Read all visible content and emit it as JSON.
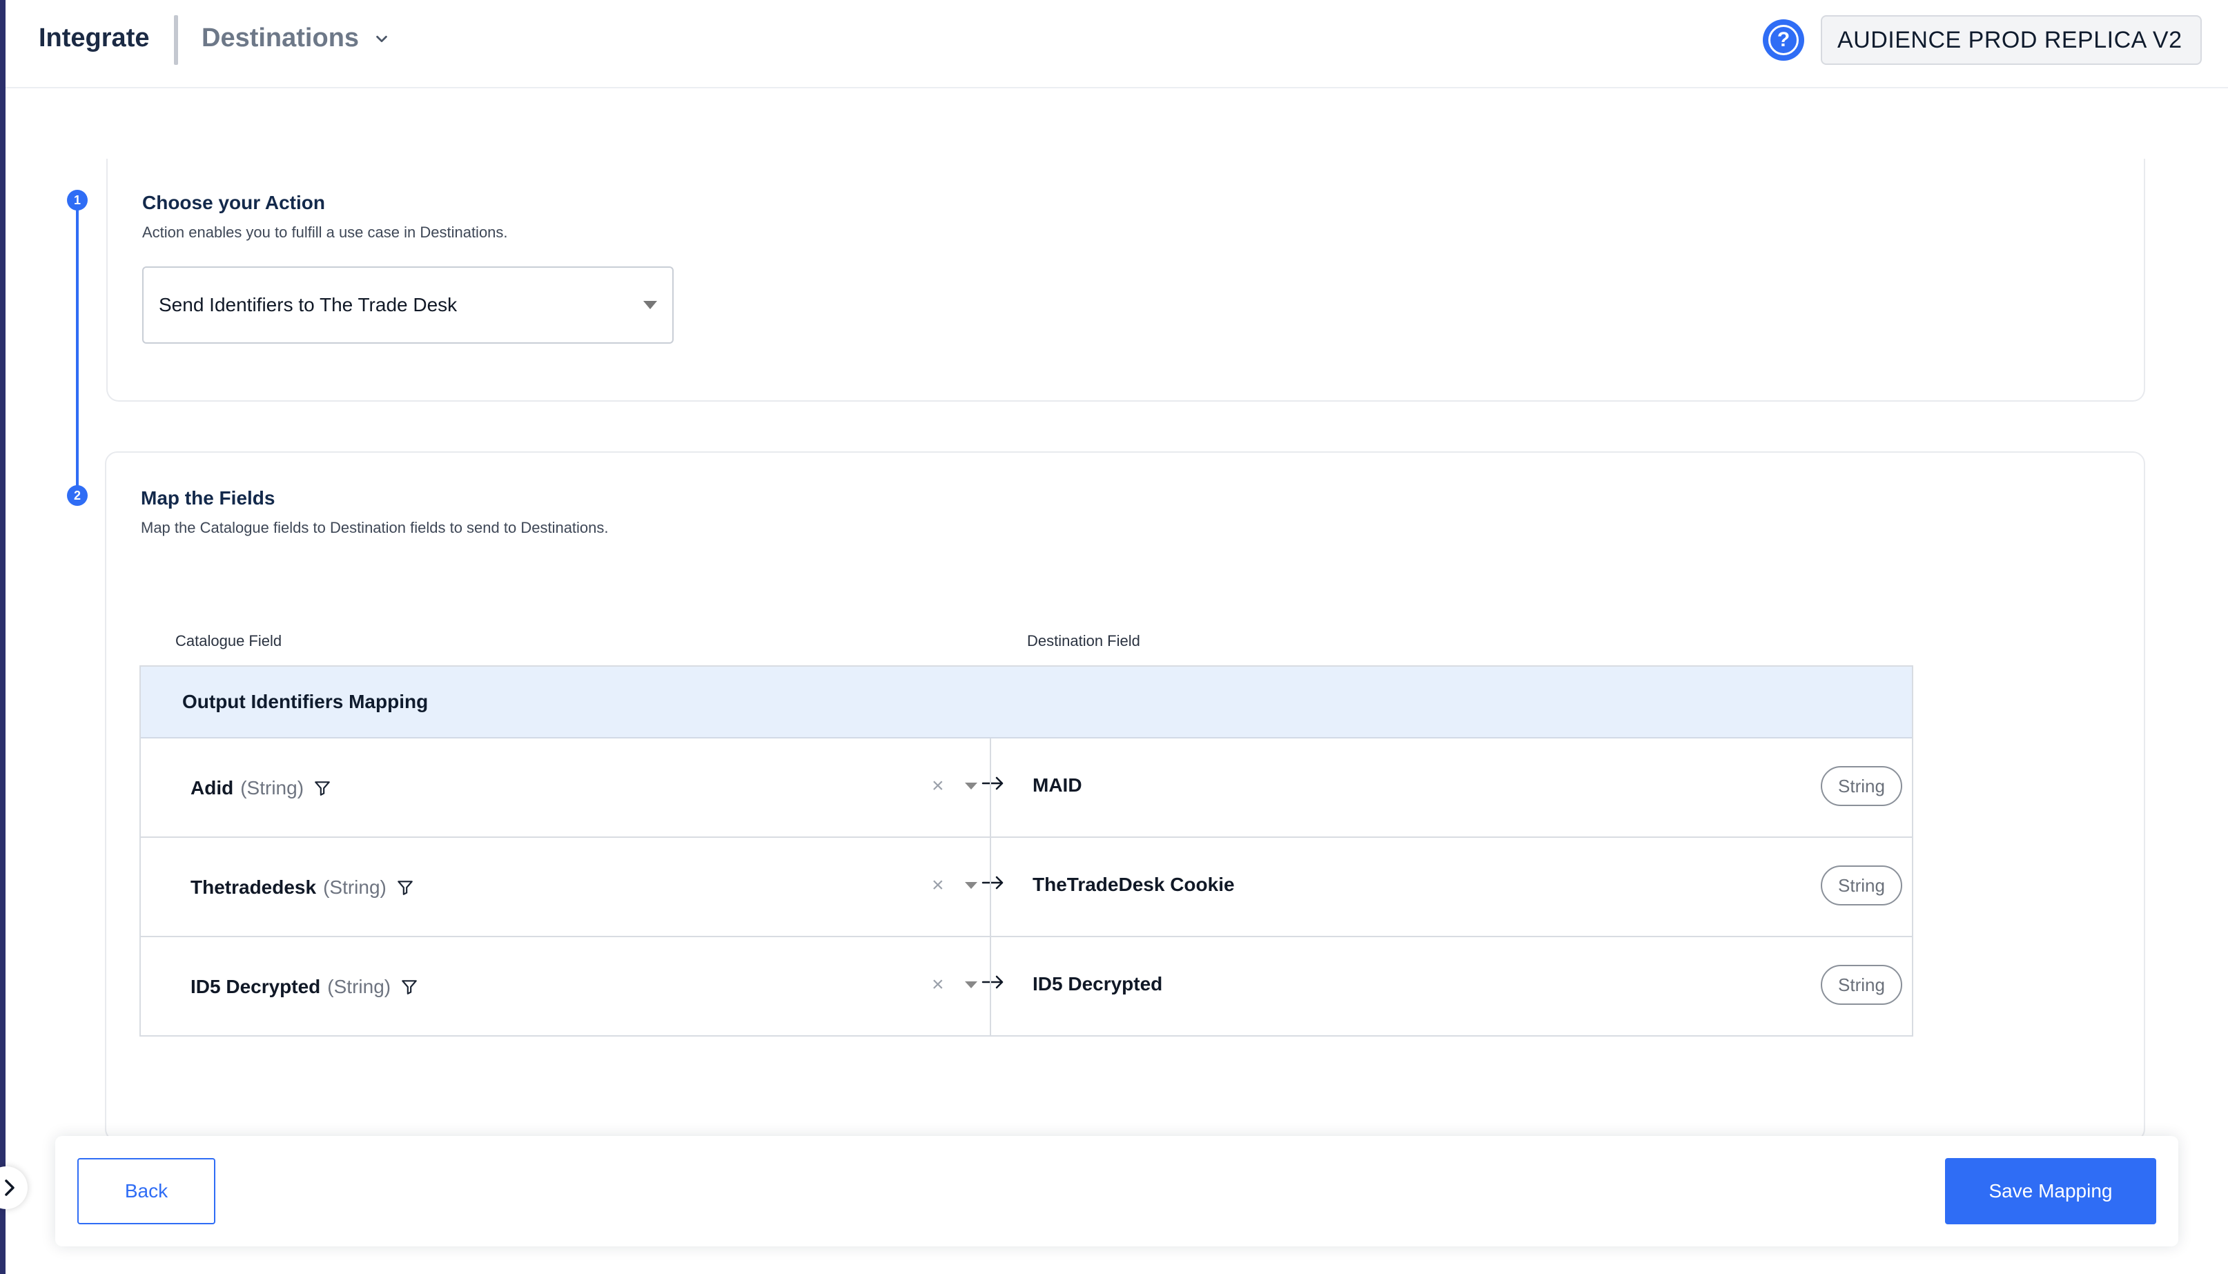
{
  "header": {
    "brand": "Integrate",
    "section": "Destinations",
    "help_icon": "question-circle-icon",
    "workspace": "AUDIENCE PROD REPLICA V2"
  },
  "steps": [
    {
      "number": "1",
      "title": "Choose your Action",
      "subtitle": "Action enables you to fulfill a use case in Destinations.",
      "select_value": "Send Identifiers to The Trade Desk"
    },
    {
      "number": "2",
      "title": "Map the Fields",
      "subtitle": "Map the Catalogue fields to Destination fields to send to Destinations."
    }
  ],
  "mapping": {
    "catalogue_header": "Catalogue Field",
    "destination_header": "Destination Field",
    "group_title": "Output Identifiers Mapping",
    "rows": [
      {
        "source": "Adid",
        "source_type": "(String)",
        "destination": "MAID",
        "dest_type": "String"
      },
      {
        "source": "Thetradedesk",
        "source_type": "(String)",
        "destination": "TheTradeDesk Cookie",
        "dest_type": "String"
      },
      {
        "source": "ID5 Decrypted",
        "source_type": "(String)",
        "destination": "ID5 Decrypted",
        "dest_type": "String"
      }
    ],
    "clear_glyph": "×"
  },
  "footer": {
    "back_label": "Back",
    "save_label": "Save Mapping"
  },
  "colors": {
    "accent": "#2f6df5",
    "brand_text": "#1b2a44",
    "group_bg": "#e7f0fc",
    "rail": "#2b2f6b"
  }
}
